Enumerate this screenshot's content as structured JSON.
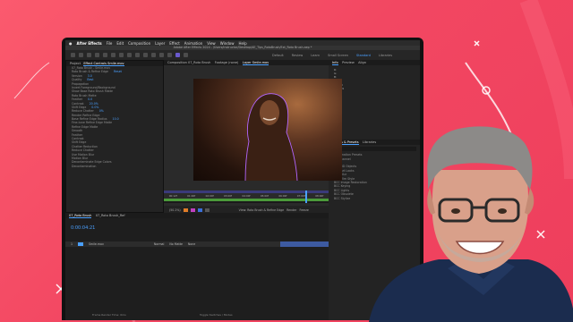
{
  "app": {
    "name": "After Effects",
    "menus": [
      "File",
      "Edit",
      "Composition",
      "Layer",
      "Effect",
      "Animation",
      "View",
      "Window",
      "Help"
    ]
  },
  "title_bar": "Adobe After Effects 2024 - /Users/instructor/Desktop/AE_Tips_RotoBrush/Ext_Roto Brush.aep *",
  "workspaces": [
    "Default",
    "Review",
    "Learn",
    "Small Screen",
    "Standard",
    "Libraries"
  ],
  "active_workspace": "Standard",
  "panels": {
    "project_tab": "Project",
    "effect_controls": "Effect Controls Smile.mov",
    "composition_tab": "Composition 07_Roto Brush",
    "footage_tab": "Footage (none)",
    "layer_tab": "Layer Smile.mov",
    "info_tab": "Info",
    "preview_tab": "Preview",
    "align_tab": "Align",
    "effects_presets": "Effects & Presets",
    "libraries": "Libraries"
  },
  "effect_rows": [
    {
      "label": "07_Roto Brush - Smile.mov",
      "value": ""
    },
    {
      "label": "Roto Brush & Refine Edge",
      "value": "Reset"
    },
    {
      "label": "Version",
      "value": "3.0"
    },
    {
      "label": "Quality",
      "value": "Best"
    },
    {
      "label": "Propagation",
      "value": ""
    },
    {
      "label": "Invert Foreground/Background",
      "value": ""
    },
    {
      "label": "Show Base Roto Brush Matte",
      "value": ""
    },
    {
      "label": "Roto Brush Matte",
      "value": ""
    },
    {
      "label": "Feather",
      "value": "0.0"
    },
    {
      "label": "Contrast",
      "value": "20.0%"
    },
    {
      "label": "Shift Edge",
      "value": "0.0%"
    },
    {
      "label": "Reduce Chatter",
      "value": "0%"
    },
    {
      "label": "Render Refine Edge",
      "value": ""
    },
    {
      "label": "Base Refine Edge Radius",
      "value": "10.0"
    },
    {
      "label": "Fine-tune Refine Edge Matte",
      "value": ""
    },
    {
      "label": "Refine Edge Matte",
      "value": ""
    },
    {
      "label": "Smooth",
      "value": ""
    },
    {
      "label": "Feather",
      "value": ""
    },
    {
      "label": "Contrast",
      "value": ""
    },
    {
      "label": "Shift Edge",
      "value": ""
    },
    {
      "label": "Chatter Reduction",
      "value": ""
    },
    {
      "label": "Reduce Chatter",
      "value": ""
    },
    {
      "label": "Use Motion Blur",
      "value": ""
    },
    {
      "label": "Motion Blur",
      "value": ""
    },
    {
      "label": "Decontaminate Edge Colors",
      "value": ""
    },
    {
      "label": "Decontamination",
      "value": ""
    }
  ],
  "ruler_labels": [
    "00:12f",
    "01:00f",
    "02:00f",
    "03:00f",
    "04:00f",
    "05:00f",
    "06:00f",
    "07:00f",
    "08:00f"
  ],
  "view_controls": {
    "zoom": "(50.2%)",
    "view": "View: Roto Brush & Refine Edge",
    "render_label": "Render",
    "freeze_label": "Freeze"
  },
  "timecode": "0:00:04:21",
  "comp_tabs": [
    "07_Roto Brush",
    "07_Roto Brush_Ref"
  ],
  "layer": {
    "index": "1",
    "name": "Smile.mov",
    "mode": "Normal",
    "track_matte": "No Matte",
    "parent": "None"
  },
  "info": {
    "r": "R:",
    "g": "G:",
    "b": "B:",
    "a": "A: 0",
    "x": "X: 480",
    "y": "Y: 1079"
  },
  "effects_list": [
    "* Animation Presets",
    "3D Channel",
    "Audio",
    "BCC 3D Objects",
    "BCC Art Looks",
    "BCC Blur",
    "BCC Film Style",
    "BCC Image Restoration",
    "BCC Keying",
    "BCC Lights",
    "BCC Obsolete",
    "BCC Stylize"
  ],
  "footer": {
    "frame_render_time": "Frame Render Time: 0ms",
    "toggle": "Toggle Switches / Modes"
  },
  "colors": {
    "background": "#f24762",
    "accent_blue": "#4aa0ff",
    "roto_outline": "#b266ff"
  }
}
